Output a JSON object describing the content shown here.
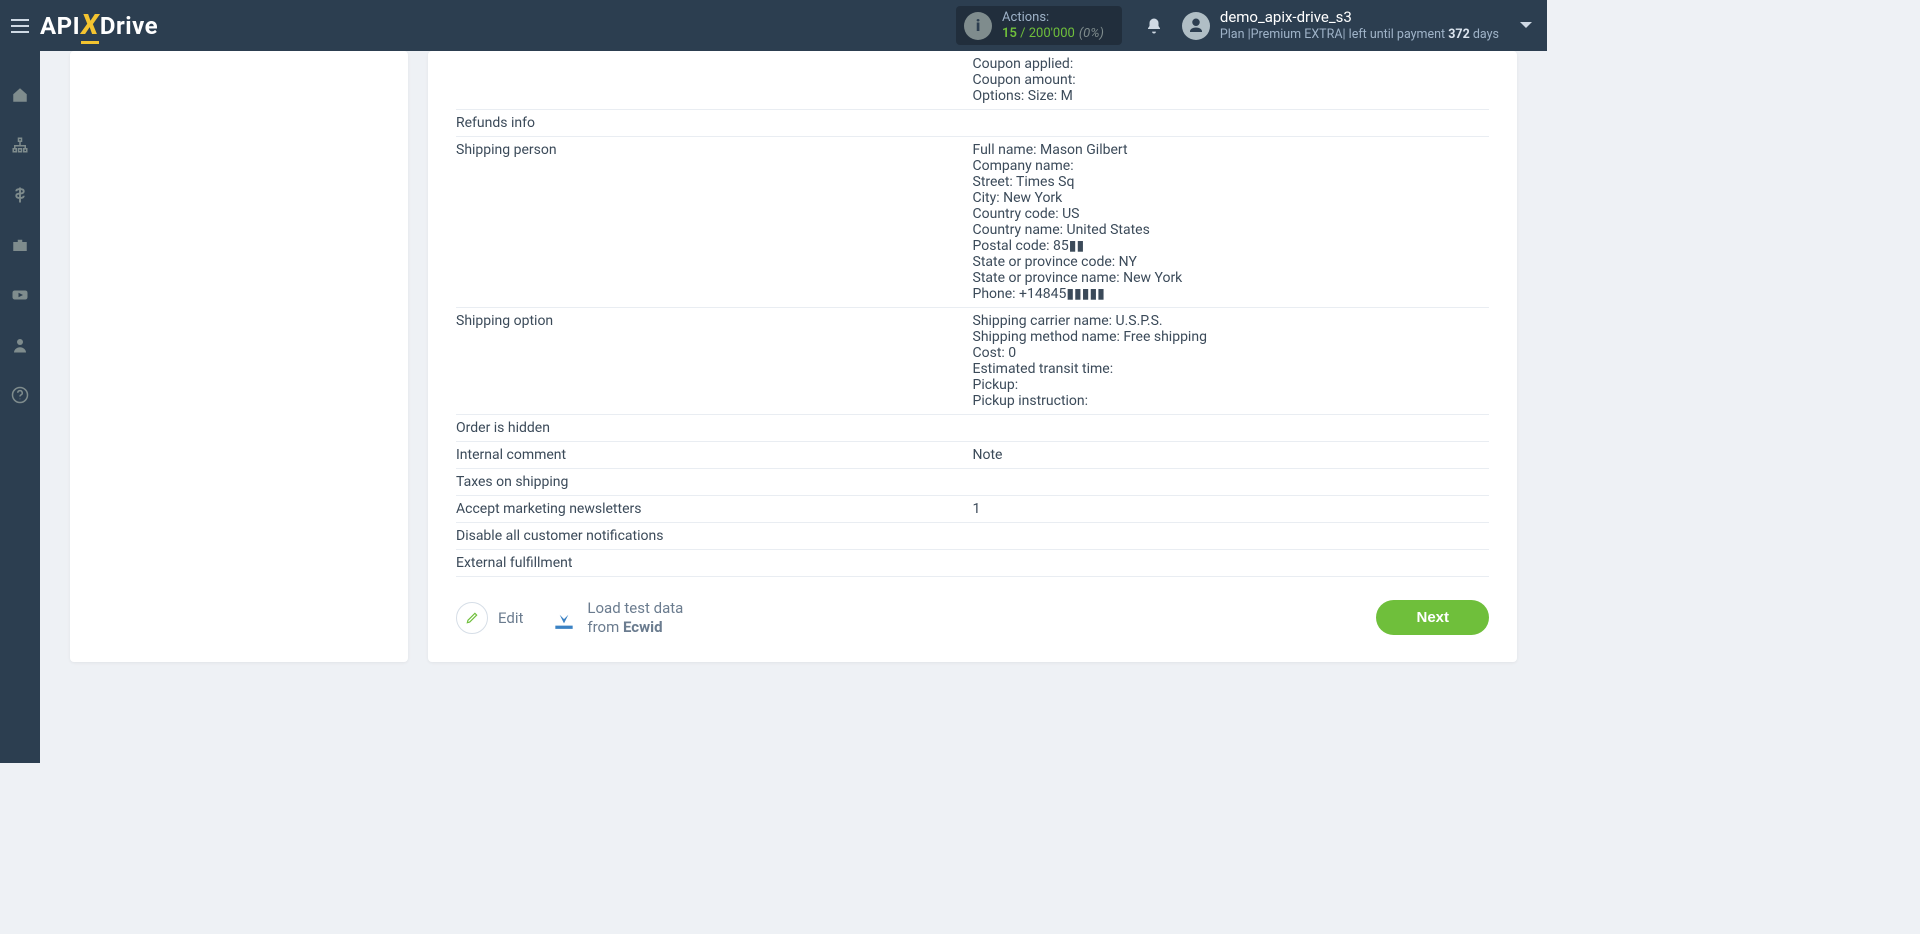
{
  "header": {
    "logo": {
      "api": "API",
      "x": "X",
      "drive": "Drive"
    },
    "actions": {
      "label": "Actions:",
      "current": "15",
      "slash": " / ",
      "max": "200'000",
      "pct": "(0%)"
    },
    "user": {
      "name": "demo_apix-drive_s3",
      "plan_prefix": "Plan |",
      "plan_name": "Premium EXTRA",
      "plan_mid": "| left until payment ",
      "days_num": "372",
      "days_suffix": " days"
    }
  },
  "details": {
    "top_lines": "Coupon applied:\nCoupon amount:\nOptions: Size: M",
    "refunds_label": "Refunds info",
    "refunds_value": "",
    "shipping_person_label": "Shipping person",
    "shipping_person_value": "Full name: Mason Gilbert\nCompany name:\nStreet: Times Sq\nCity: New York\nCountry code: US\nCountry name: United States\nPostal code: 85▮▮\nState or province code: NY\nState or province name: New York\nPhone: +14845▮▮▮▮▮",
    "shipping_option_label": "Shipping option",
    "shipping_option_value": "Shipping carrier name: U.S.P.S.\nShipping method name: Free shipping\nCost: 0\nEstimated transit time:\nPickup:\nPickup instruction:",
    "order_hidden_label": "Order is hidden",
    "order_hidden_value": "",
    "internal_comment_label": "Internal comment",
    "internal_comment_value": "Note",
    "taxes_shipping_label": "Taxes on shipping",
    "taxes_shipping_value": "",
    "accept_marketing_label": "Accept marketing newsletters",
    "accept_marketing_value": "1",
    "disable_notif_label": "Disable all customer notifications",
    "disable_notif_value": "",
    "external_fulfill_label": "External fulfillment",
    "external_fulfill_value": ""
  },
  "footer": {
    "edit": "Edit",
    "load_line1": "Load test data",
    "load_from": "from ",
    "load_source": "Ecwid",
    "next": "Next"
  }
}
